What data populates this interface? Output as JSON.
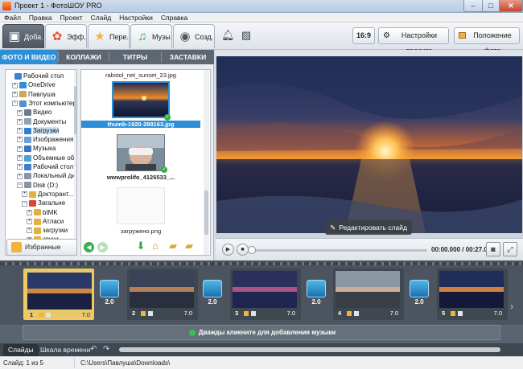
{
  "window": {
    "title": "Проект 1 - ФотоШОУ PRO",
    "minimize": "–",
    "maximize": "□",
    "close": "✕"
  },
  "menu": [
    "Файл",
    "Правка",
    "Проект",
    "Слайд",
    "Настройки",
    "Справка"
  ],
  "toolbar": {
    "tabs": [
      {
        "label": "Доба...",
        "icon": "photo-add-icon"
      },
      {
        "label": "Эфф...",
        "icon": "effects-icon"
      },
      {
        "label": "Пере...",
        "icon": "transitions-star-icon"
      },
      {
        "label": "Музы...",
        "icon": "music-icon"
      },
      {
        "label": "Созд...",
        "icon": "create-disc-icon"
      }
    ],
    "aspect_label": "16:9",
    "project_settings_label": "Настройки проекта",
    "photo_position_label": "Положение фото"
  },
  "left_panel": {
    "subtabs": [
      "ФОТО И ВИДЕО",
      "КОЛЛАЖИ",
      "ТИТРЫ",
      "ЗАСТАВКИ"
    ],
    "tree": [
      {
        "label": "Рабочий стол",
        "exp": "",
        "icon_color": "#3d7fd1"
      },
      {
        "label": "OneDrive",
        "exp": "+",
        "icon_color": "#2f8fd6"
      },
      {
        "label": "Павлуша",
        "exp": "+",
        "icon_color": "#d3a35a"
      },
      {
        "label": "Этот компьютер",
        "exp": "−",
        "icon_color": "#5b8fc9"
      },
      {
        "label": "Видео",
        "exp": "+",
        "icon_color": "#6d7b8a"
      },
      {
        "label": "Документы",
        "exp": "+",
        "icon_color": "#8fa3b8"
      },
      {
        "label": "Загрузки",
        "exp": "+",
        "icon_color": "#2f7fd1"
      },
      {
        "label": "Изображения",
        "exp": "+",
        "icon_color": "#6d9fd4"
      },
      {
        "label": "Музыка",
        "exp": "+",
        "icon_color": "#3b73c4"
      },
      {
        "label": "Объемные об...",
        "exp": "+",
        "icon_color": "#4ea0d8"
      },
      {
        "label": "Рабочий стол",
        "exp": "+",
        "icon_color": "#3d7fd1"
      },
      {
        "label": "Локальный ди...",
        "exp": "+",
        "icon_color": "#8a96a3"
      },
      {
        "label": "Disk (D:)",
        "exp": "−",
        "icon_color": "#8a96a3"
      },
      {
        "label": "Докторант...",
        "exp": "+",
        "icon_color": "#e0b13c"
      },
      {
        "label": "Загальне",
        "exp": "−",
        "icon_color": "#d9472d"
      },
      {
        "label": "bIMK",
        "exp": "+",
        "icon_color": "#e0b13c"
      },
      {
        "label": "Атласи",
        "exp": "+",
        "icon_color": "#e0b13c"
      },
      {
        "label": "загрузки",
        "exp": "+",
        "icon_color": "#e0b13c"
      },
      {
        "label": "звуки",
        "exp": "+",
        "icon_color": "#e0b13c"
      }
    ],
    "files": [
      {
        "name": "rabstol_net_sunset_23.jpg"
      },
      {
        "name": "thumb-1920-288163.jpg"
      },
      {
        "name": "wwwprolifo_4126533_..."
      },
      {
        "name": "загружено.png"
      }
    ],
    "favorites_label": "Избранные папки"
  },
  "preview": {
    "edit_slide_label": "Редактировать слайд",
    "timecode": "00:00.000 / 00:27.000",
    "progress": 0.0
  },
  "timeline": {
    "slides": [
      {
        "num": "1",
        "duration": "7.0"
      },
      {
        "num": "2",
        "duration": "7.0"
      },
      {
        "num": "3",
        "duration": "7.0"
      },
      {
        "num": "4",
        "duration": "7.0"
      },
      {
        "num": "5",
        "duration": "7.0"
      }
    ],
    "transitions": [
      "2.0",
      "2.0",
      "2.0",
      "2.0",
      "2.0"
    ],
    "music_hint": "Дважды кликните для добавления музыки"
  },
  "bottom_tabs": [
    "Слайды",
    "Шкала времени"
  ],
  "status": {
    "slide_count": "Слайд: 1 из 5",
    "path": "C:\\Users\\Павлуша\\Downloads\\"
  },
  "colors": {
    "accent": "#2f8fd6",
    "selected_slide": "#f5c95b"
  }
}
